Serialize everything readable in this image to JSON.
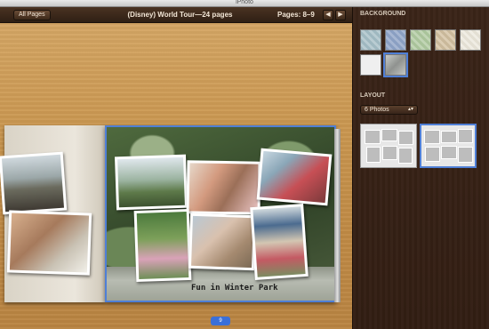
{
  "window": {
    "title": "iPhoto"
  },
  "toolbar": {
    "all_pages_label": "All Pages",
    "book_title": "(Disney) World Tour—24 pages",
    "pages_label": "Pages: 8–9",
    "prev_label": "◀",
    "next_label": "▶"
  },
  "spread": {
    "caption": "Fun in Winter Park",
    "page_badge": "9"
  },
  "sidebar": {
    "background_label": "BACKGROUND",
    "layout_label": "LAYOUT",
    "layout_dropdown": "6 Photos",
    "layout_chevron": "▴▾",
    "background_swatches": [
      {
        "color": "#9fb8c0",
        "selected": false
      },
      {
        "color": "#8a9fc2",
        "selected": false
      },
      {
        "color": "#a9c39a",
        "selected": false
      },
      {
        "color": "#c9b89a",
        "selected": false
      },
      {
        "color": "#e3dfd3",
        "selected": false
      },
      {
        "color": "#efefef",
        "selected": false
      },
      {
        "color": "#aeb0ae",
        "selected": true
      }
    ]
  },
  "colors": {
    "accent": "#4f7fd6",
    "toolbar": "#3c2819",
    "wood": "#c9964f",
    "sidebar": "#3a2418"
  }
}
